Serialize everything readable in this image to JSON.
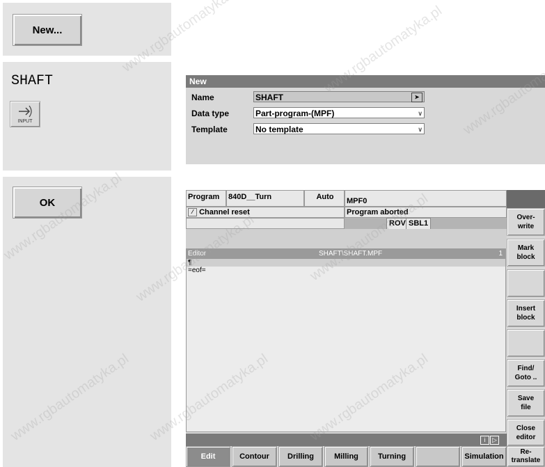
{
  "step1": {
    "button_label": "New..."
  },
  "step2": {
    "typed_text": "SHAFT",
    "input_key_label": "INPUT"
  },
  "step3": {
    "button_label": "OK"
  },
  "new_dialog": {
    "title": "New",
    "name_label": "Name",
    "name_value": "SHAFT",
    "data_type_label": "Data type",
    "data_type_value": "Part-program-(MPF)",
    "template_label": "Template",
    "template_value": "No template"
  },
  "hmi": {
    "area": "Program",
    "machine": "840D__Turn",
    "mode": "Auto",
    "program_name": "MPF0",
    "channel_status": "Channel reset",
    "program_status": "Program aborted",
    "rov": "ROV",
    "sbl": "SBL1",
    "editor_label": "Editor",
    "editor_path": "SHAFT\\SHAFT.MPF",
    "editor_line": "1",
    "editor_lines": [
      "¶",
      "=eof="
    ],
    "vertical_softkeys": [
      "Over-\nwrite",
      "Mark\nblock",
      "",
      "Insert\nblock",
      "",
      "Find/\nGoto ..",
      "Save\nfile",
      "Close\neditor",
      "Re-\ntranslate"
    ],
    "horizontal_softkeys": [
      "Edit",
      "Contour",
      "Drilling",
      "Milling",
      "Turning",
      "",
      "Simulation"
    ]
  },
  "watermark": "www.rgbautomatyka.pl"
}
